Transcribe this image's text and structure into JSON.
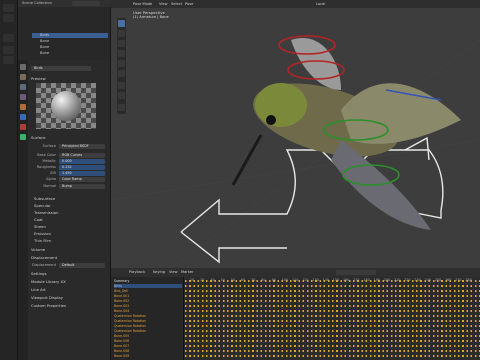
{
  "outliner": {
    "title": "Scene Collection",
    "rows": [
      "Birds",
      "Bone",
      "Bone",
      "Bone"
    ]
  },
  "props": {
    "object_field": "Birds",
    "preview_label": "Preview",
    "surface_header": "Surface",
    "rows": [
      {
        "label": "Surface",
        "value": "Principled BSDF"
      },
      {
        "label": "Base Color",
        "value": "RGB Curves"
      },
      {
        "label": "Metallic",
        "value": "0.000"
      },
      {
        "label": "Roughness",
        "value": "0.232"
      },
      {
        "label": "IOR",
        "value": "1.450"
      },
      {
        "label": "Alpha",
        "value": "Color Ramp"
      },
      {
        "label": "Normal",
        "value": "Bump"
      }
    ],
    "subsections": [
      "Subsurface",
      "Specular",
      "Transmission",
      "Coat",
      "Sheen",
      "Emission",
      "Thin Film"
    ],
    "volume": "Volume",
    "displacement_header": "Displacement",
    "displacement": {
      "label": "Displacement",
      "value": "Default"
    },
    "bottom": [
      "Settings",
      "Module Library XX",
      "Line Art",
      "Viewport Display",
      "Custom Properties"
    ]
  },
  "viewport": {
    "menus": [
      "Pose Mode",
      "View",
      "Select",
      "Pose"
    ],
    "overlay_title": "User Perspective",
    "overlay_sub": "(1) Armature | Bone",
    "transform": "Local"
  },
  "timeline": {
    "menus": [
      "Playback",
      "Keying",
      "View",
      "Marker"
    ],
    "channels": [
      "Summary",
      "Birds",
      "Bird_Dell",
      "Bone.001",
      "Bone.002",
      "Bone.003",
      "Bone.004",
      "Quaternion Rotation",
      "Quaternion Rotation",
      "Quaternion Rotation",
      "Quaternion Rotation",
      "Bone.005",
      "Bone.006",
      "Bone.007",
      "Bone.008",
      "Bone.009"
    ],
    "frames": [
      "10",
      "20",
      "30",
      "40",
      "50",
      "60",
      "70",
      "80",
      "90",
      "100",
      "110",
      "120",
      "130",
      "140",
      "150",
      "160",
      "170",
      "180",
      "190",
      "200",
      "210",
      "220",
      "230",
      "240",
      "250",
      "260",
      "270",
      "280"
    ]
  },
  "colors": {
    "accent": "#e6a13a",
    "select_blue": "#2f4f7a",
    "key": "#d9a630"
  }
}
